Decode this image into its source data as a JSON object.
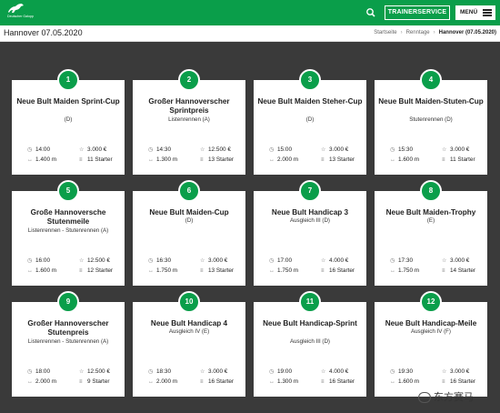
{
  "header": {
    "logo_text": "Deutscher Galopp",
    "trainer_label": "TRAINERSERVICE",
    "menu_label": "MENÜ"
  },
  "page": {
    "title": "Hannover 07.05.2020",
    "breadcrumb": [
      "Startseite",
      "Renntage",
      "Hannover (07.05.2020)"
    ]
  },
  "races": [
    {
      "num": "1",
      "name": "Neue Bult Maiden Sprint-Cup",
      "cat": "(D)",
      "time": "14:00",
      "prize": "3.000 €",
      "dist": "1.400 m",
      "starters": "11 Starter"
    },
    {
      "num": "2",
      "name": "Großer Hannoverscher Sprintpreis",
      "cat": "Listenrennen (A)",
      "time": "14:30",
      "prize": "12.500 €",
      "dist": "1.300 m",
      "starters": "13 Starter"
    },
    {
      "num": "3",
      "name": "Neue Bult Maiden Steher-Cup",
      "cat": "(D)",
      "time": "15:00",
      "prize": "3.000 €",
      "dist": "2.000 m",
      "starters": "13 Starter"
    },
    {
      "num": "4",
      "name": "Neue Bult Maiden-Stuten-Cup",
      "cat": "Stutenrennen (D)",
      "time": "15:30",
      "prize": "3.000 €",
      "dist": "1.600 m",
      "starters": "11 Starter"
    },
    {
      "num": "5",
      "name": "Große Hannoversche Stutenmeile",
      "cat": "Listenrennen - Stutenrennen (A)",
      "time": "16:00",
      "prize": "12.500 €",
      "dist": "1.600 m",
      "starters": "12 Starter"
    },
    {
      "num": "6",
      "name": "Neue Bult Maiden-Cup",
      "cat": "(D)",
      "time": "16:30",
      "prize": "3.000 €",
      "dist": "1.750 m",
      "starters": "13 Starter"
    },
    {
      "num": "7",
      "name": "Neue Bult Handicap 3",
      "cat": "Ausgleich III (D)",
      "time": "17:00",
      "prize": "4.000 €",
      "dist": "1.750 m",
      "starters": "16 Starter"
    },
    {
      "num": "8",
      "name": "Neue Bult Maiden-Trophy",
      "cat": "(E)",
      "time": "17:30",
      "prize": "3.000 €",
      "dist": "1.750 m",
      "starters": "14 Starter"
    },
    {
      "num": "9",
      "name": "Großer Hannoverscher Stutenpreis",
      "cat": "Listenrennen - Stutenrennen (A)",
      "time": "18:00",
      "prize": "12.500 €",
      "dist": "2.000 m",
      "starters": "9 Starter"
    },
    {
      "num": "10",
      "name": "Neue Bult Handicap 4",
      "cat": "Ausgleich IV (E)",
      "time": "18:30",
      "prize": "3.000 €",
      "dist": "2.000 m",
      "starters": "16 Starter"
    },
    {
      "num": "11",
      "name": "Neue Bult Handicap-Sprint",
      "cat": "Ausgleich III (D)",
      "time": "19:00",
      "prize": "4.000 €",
      "dist": "1.300 m",
      "starters": "16 Starter"
    },
    {
      "num": "12",
      "name": "Neue Bult Handicap-Meile",
      "cat": "Ausgleich IV (F)",
      "time": "19:30",
      "prize": "3.000 €",
      "dist": "1.600 m",
      "starters": "16 Starter"
    }
  ],
  "watermark": "东方赛马",
  "colors": {
    "brand": "#0a9e4a",
    "background": "#3a3a3a"
  }
}
